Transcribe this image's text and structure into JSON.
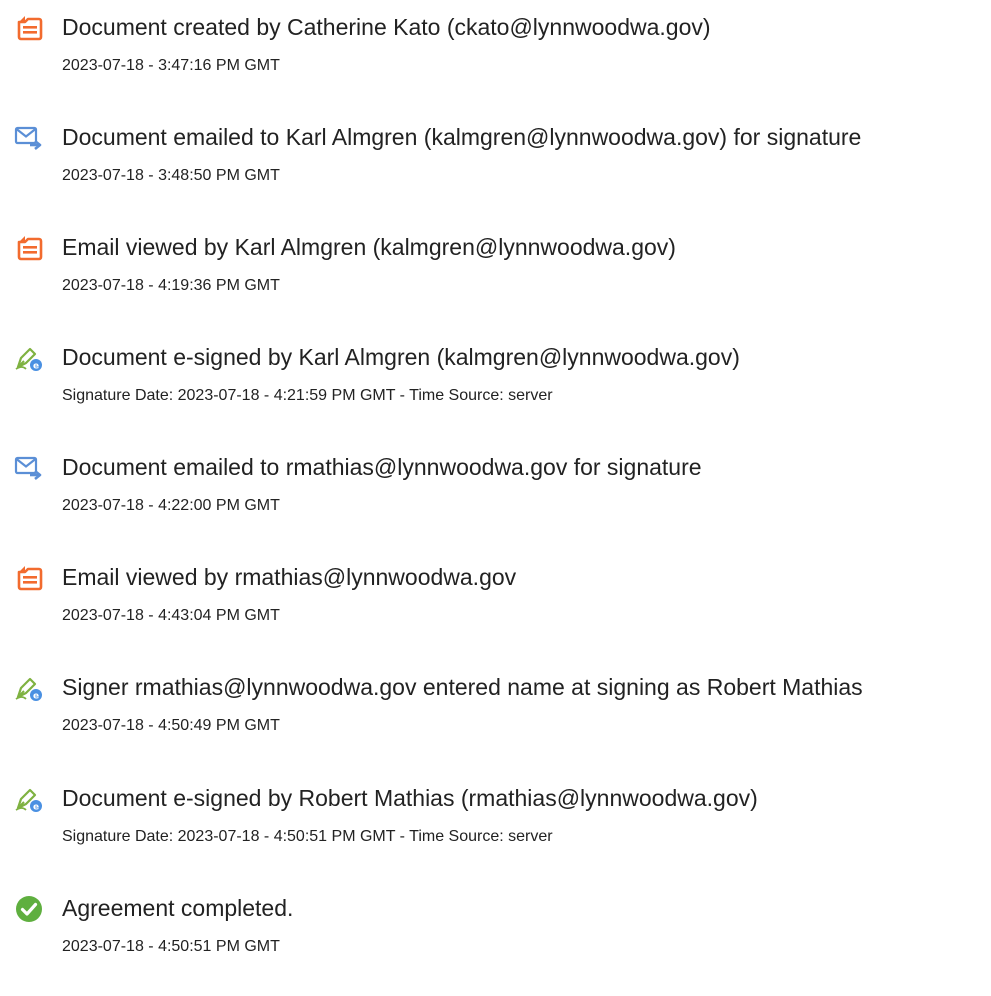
{
  "colors": {
    "document_icon": "#F26B2E",
    "email_icon": "#5B8FD6",
    "esign_icon": "#7FB241",
    "esign_badge": "#4A90E2",
    "completed_icon": "#5FAF3F"
  },
  "events": [
    {
      "icon": "document-icon",
      "title": "Document created by Catherine Kato (ckato@lynnwoodwa.gov)",
      "timestamp": "2023-07-18 - 3:47:16 PM GMT"
    },
    {
      "icon": "email-icon",
      "title": "Document emailed to Karl Almgren (kalmgren@lynnwoodwa.gov) for signature",
      "timestamp": "2023-07-18 - 3:48:50 PM GMT"
    },
    {
      "icon": "document-icon",
      "title": "Email viewed by Karl Almgren (kalmgren@lynnwoodwa.gov)",
      "timestamp": "2023-07-18 - 4:19:36 PM GMT"
    },
    {
      "icon": "esign-icon",
      "title": "Document e-signed by Karl Almgren (kalmgren@lynnwoodwa.gov)",
      "timestamp": "Signature Date: 2023-07-18 - 4:21:59 PM GMT - Time Source: server"
    },
    {
      "icon": "email-icon",
      "title": "Document emailed to rmathias@lynnwoodwa.gov for signature",
      "timestamp": "2023-07-18 - 4:22:00 PM GMT"
    },
    {
      "icon": "document-icon",
      "title": "Email viewed by rmathias@lynnwoodwa.gov",
      "timestamp": "2023-07-18 - 4:43:04 PM GMT"
    },
    {
      "icon": "esign-icon",
      "title": "Signer rmathias@lynnwoodwa.gov entered name at signing as Robert Mathias",
      "timestamp": "2023-07-18 - 4:50:49 PM GMT"
    },
    {
      "icon": "esign-icon",
      "title": "Document e-signed by Robert Mathias (rmathias@lynnwoodwa.gov)",
      "timestamp": "Signature Date: 2023-07-18 - 4:50:51 PM GMT - Time Source: server"
    },
    {
      "icon": "checkmark-icon",
      "title": "Agreement completed.",
      "timestamp": "2023-07-18 - 4:50:51 PM GMT"
    }
  ]
}
